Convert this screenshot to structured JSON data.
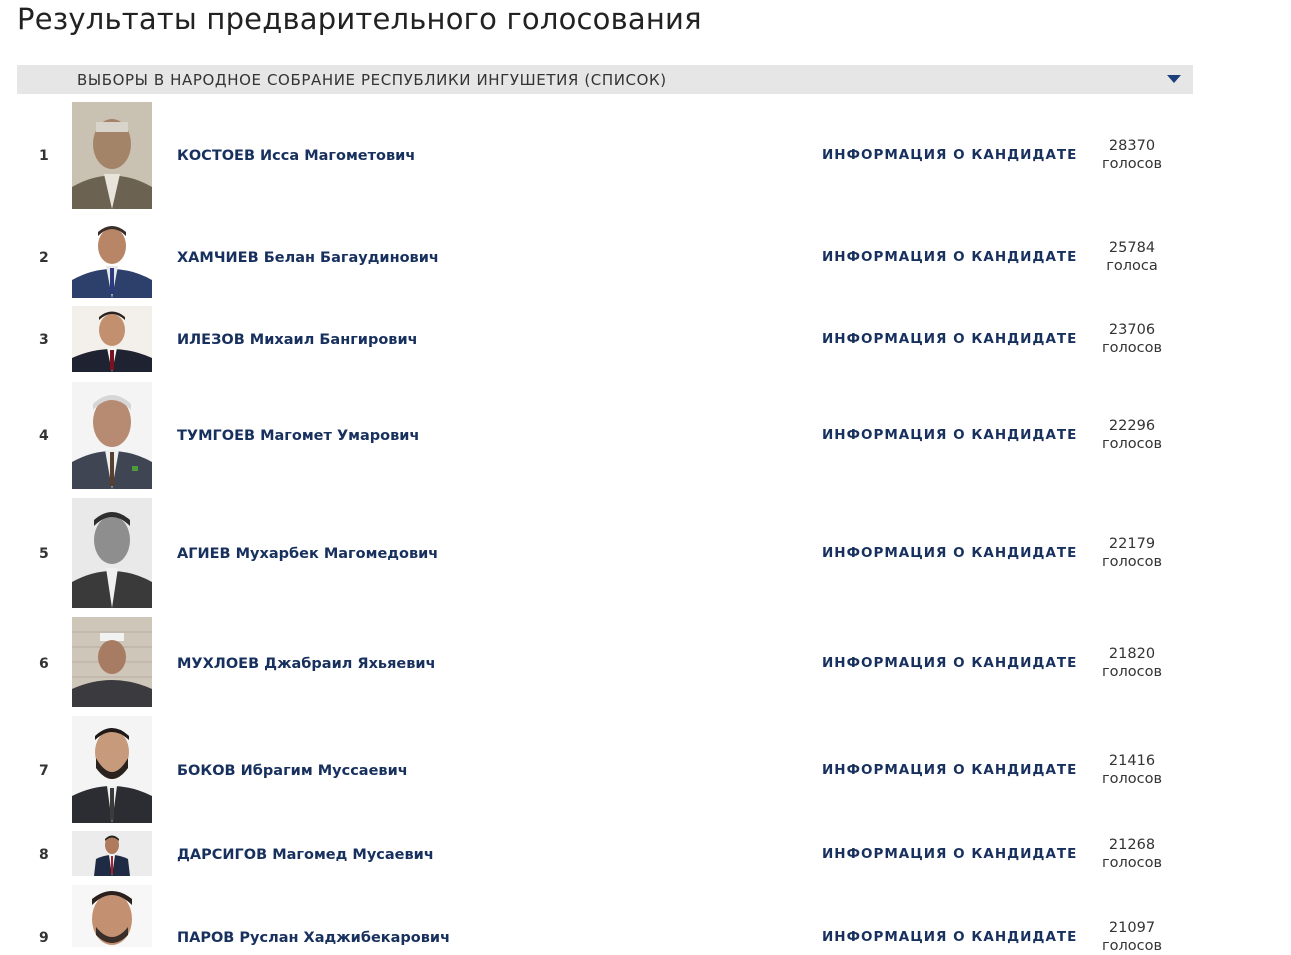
{
  "page": {
    "title": "Результаты предварительного голосования"
  },
  "section": {
    "title": "ВЫБОРЫ В НАРОДНОЕ СОБРАНИЕ РЕСПУБЛИКИ ИНГУШЕТИЯ (СПИСОК)",
    "expand_icon": "chevron-down-icon"
  },
  "candidates": [
    {
      "rank": "1",
      "name": "КОСТОЕВ Исса Магометович",
      "info_label": "ИНФОРМАЦИЯ О КАНДИДАТЕ",
      "votes": "28370",
      "votes_unit": "голосов"
    },
    {
      "rank": "2",
      "name": "ХАМЧИЕВ Белан Багаудинович",
      "info_label": "ИНФОРМАЦИЯ О КАНДИДАТЕ",
      "votes": "25784",
      "votes_unit": "голоса"
    },
    {
      "rank": "3",
      "name": "ИЛЕЗОВ Михаил Бангирович",
      "info_label": "ИНФОРМАЦИЯ О КАНДИДАТЕ",
      "votes": "23706",
      "votes_unit": "голосов"
    },
    {
      "rank": "4",
      "name": "ТУМГОЕВ Магомет Умарович",
      "info_label": "ИНФОРМАЦИЯ О КАНДИДАТЕ",
      "votes": "22296",
      "votes_unit": "голосов"
    },
    {
      "rank": "5",
      "name": "АГИЕВ Мухарбек Магомедович",
      "info_label": "ИНФОРМАЦИЯ О КАНДИДАТЕ",
      "votes": "22179",
      "votes_unit": "голосов"
    },
    {
      "rank": "6",
      "name": "МУХЛОЕВ Джабраил Яхьяевич",
      "info_label": "ИНФОРМАЦИЯ О КАНДИДАТЕ",
      "votes": "21820",
      "votes_unit": "голосов"
    },
    {
      "rank": "7",
      "name": "БОКОВ Ибрагим Муссаевич",
      "info_label": "ИНФОРМАЦИЯ О КАНДИДАТЕ",
      "votes": "21416",
      "votes_unit": "голосов"
    },
    {
      "rank": "8",
      "name": "ДАРСИГОВ Магомед Мусаевич",
      "info_label": "ИНФОРМАЦИЯ О КАНДИДАТЕ",
      "votes": "21268",
      "votes_unit": "голосов"
    },
    {
      "rank": "9",
      "name": "ПАРОВ Руслан Хаджибекарович",
      "info_label": "ИНФОРМАЦИЯ О КАНДИДАТЕ",
      "votes": "21097",
      "votes_unit": "голосов"
    }
  ]
}
